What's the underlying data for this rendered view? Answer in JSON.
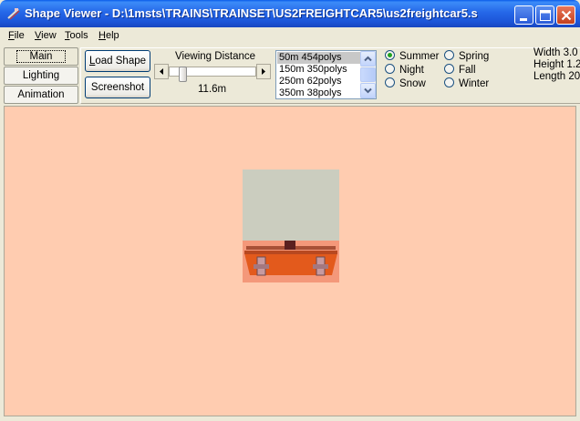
{
  "window": {
    "title": "Shape Viewer - D:\\1msts\\TRAINS\\TRAINSET\\US2FREIGHTCAR5\\us2freightcar5.s",
    "app_icon": "train-icon",
    "controls": [
      "minimize-icon",
      "maximize-icon",
      "close-icon"
    ]
  },
  "menu": {
    "items": [
      {
        "key": "F",
        "rest": "ile"
      },
      {
        "key": "V",
        "rest": "iew"
      },
      {
        "key": "T",
        "rest": "ools"
      },
      {
        "key": "H",
        "rest": "elp"
      }
    ]
  },
  "tabs": {
    "items": [
      "Main",
      "Lighting",
      "Animation"
    ],
    "active": "Main"
  },
  "buttons": {
    "load_shape": "Load Shape",
    "screenshot": "Screenshot"
  },
  "viewing_distance": {
    "label": "Viewing Distance",
    "value": "11.6m",
    "slider_fraction": 0.12
  },
  "lod": {
    "items": [
      "50m 454polys",
      "150m 350polys",
      "250m 62polys",
      "350m 38polys"
    ],
    "selected": 0
  },
  "seasons": {
    "options": [
      "Summer",
      "Spring",
      "Night",
      "Fall",
      "Snow",
      "Winter"
    ],
    "selected": "Summer"
  },
  "dimensions": {
    "width": "Width 3.0",
    "height": "Height 1.2",
    "length": "Length 20"
  },
  "colors": {
    "viewport_bg": "#FFCCB0",
    "titlebar": "#2567E8",
    "radio_selected": "#21A121",
    "car_body": "#CBCDBF",
    "car_underframe": "#E35A1C"
  }
}
